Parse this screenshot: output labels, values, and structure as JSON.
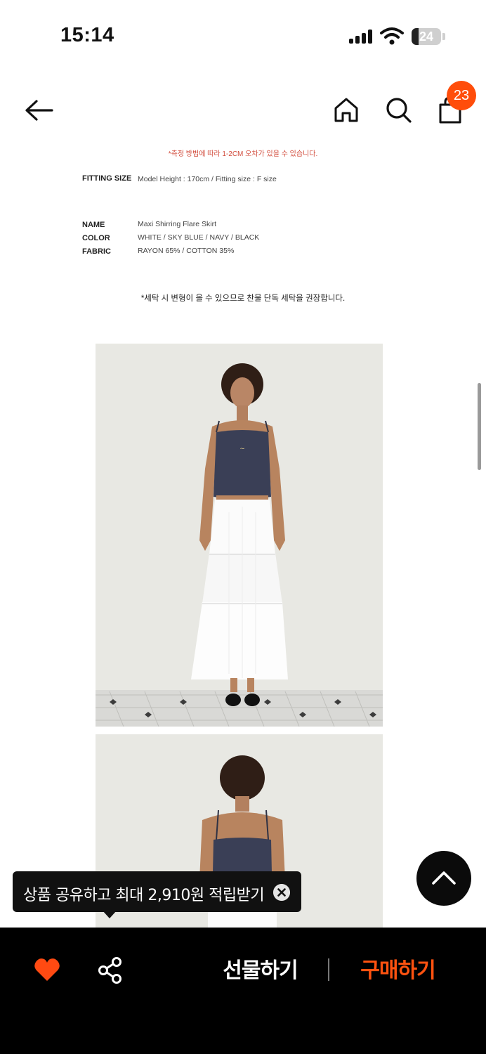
{
  "status_bar": {
    "time": "15:14",
    "battery": "24",
    "battery_level": 0.24,
    "icons": [
      "signal-icon",
      "wifi-icon",
      "battery-icon"
    ]
  },
  "header": {
    "icons": [
      "back-arrow-icon",
      "home-icon",
      "search-icon",
      "shopping-bag-icon"
    ],
    "cart_count": "23"
  },
  "product_info": {
    "measure_note": "*측정 방법에 따라 1-2CM 오차가 있을 수 있습니다.",
    "fitting": {
      "label": "FITTING SIZE",
      "value": "Model Height : 170cm / Fitting size : F size"
    },
    "specs": [
      {
        "label": "NAME",
        "value": "Maxi Shirring Flare Skirt"
      },
      {
        "label": "COLOR",
        "value": "WHITE / SKY BLUE / NAVY / BLACK"
      },
      {
        "label": "FABRIC",
        "value": "RAYON 65% / COTTON 35%"
      }
    ],
    "wash_note": "*세탁 시 변형이 올 수 있으므로 찬물 단독 세탁을 권장합니다."
  },
  "photos": [
    {
      "label": "model-front-photo"
    },
    {
      "label": "model-back-photo"
    }
  ],
  "toast": {
    "text": "상품 공유하고 최대 2,910원 적립받기",
    "icon": "close-icon"
  },
  "scroll_top": {
    "icon": "chevron-up-icon"
  },
  "bottom_bar": {
    "gift_label": "선물하기",
    "buy_label": "구매하기",
    "icons": [
      "heart-icon",
      "share-icon"
    ]
  },
  "colors": {
    "accent": "#ff5210",
    "badge": "#ff4d0a",
    "note_red": "#d14a3a",
    "bar_background": "#000000"
  }
}
